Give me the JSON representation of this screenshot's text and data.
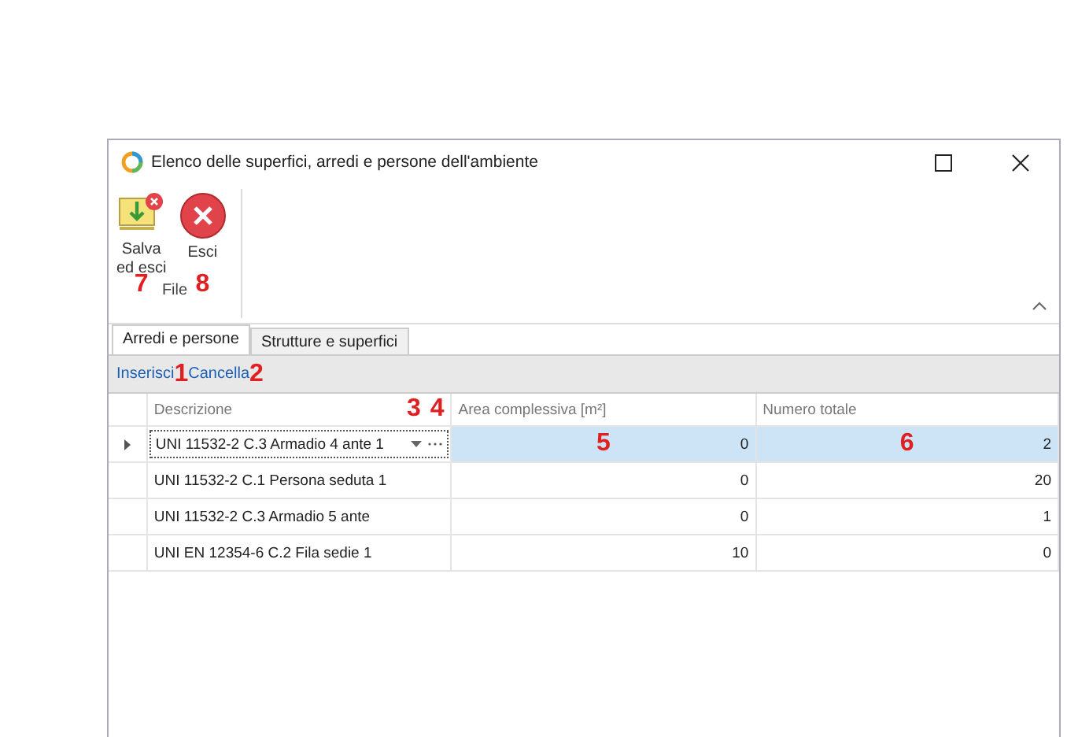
{
  "window": {
    "title": "Elenco delle superfici, arredi e persone dell'ambiente"
  },
  "ribbon": {
    "buttons": [
      {
        "kind": "save-exit",
        "label": "Salva\ned esci",
        "callout": "7"
      },
      {
        "kind": "exit",
        "label": "Esci",
        "callout": "8"
      }
    ],
    "group": "File"
  },
  "tabs": [
    {
      "label": "Arredi e persone",
      "selected": true
    },
    {
      "label": "Strutture e superfici",
      "selected": false
    }
  ],
  "toolbar": [
    {
      "label": "Inserisci",
      "callout": "1"
    },
    {
      "label": "Cancella",
      "callout": "2"
    }
  ],
  "table": {
    "columns": [
      {
        "label": "Descrizione",
        "callouts": [
          "3",
          "4"
        ]
      },
      {
        "label": "Area complessiva [m²]"
      },
      {
        "label": "Numero totale"
      }
    ],
    "rows": [
      {
        "selected": true,
        "cells": [
          {
            "text": "UNI 11532-2 C.3 Armadio 4 ante 1"
          },
          {
            "text": "0",
            "callout": "5"
          },
          {
            "text": "2",
            "callout": "6"
          }
        ]
      },
      {
        "selected": false,
        "cells": [
          {
            "text": "UNI 11532-2 C.1 Persona seduta 1"
          },
          {
            "text": "0"
          },
          {
            "text": "20"
          }
        ]
      },
      {
        "selected": false,
        "cells": [
          {
            "text": "UNI 11532-2 C.3 Armadio 5 ante"
          },
          {
            "text": "0"
          },
          {
            "text": "1"
          }
        ]
      },
      {
        "selected": false,
        "cells": [
          {
            "text": "UNI EN 12354-6 C.2 Fila sedie 1"
          },
          {
            "text": "10"
          },
          {
            "text": "0"
          }
        ]
      }
    ]
  }
}
